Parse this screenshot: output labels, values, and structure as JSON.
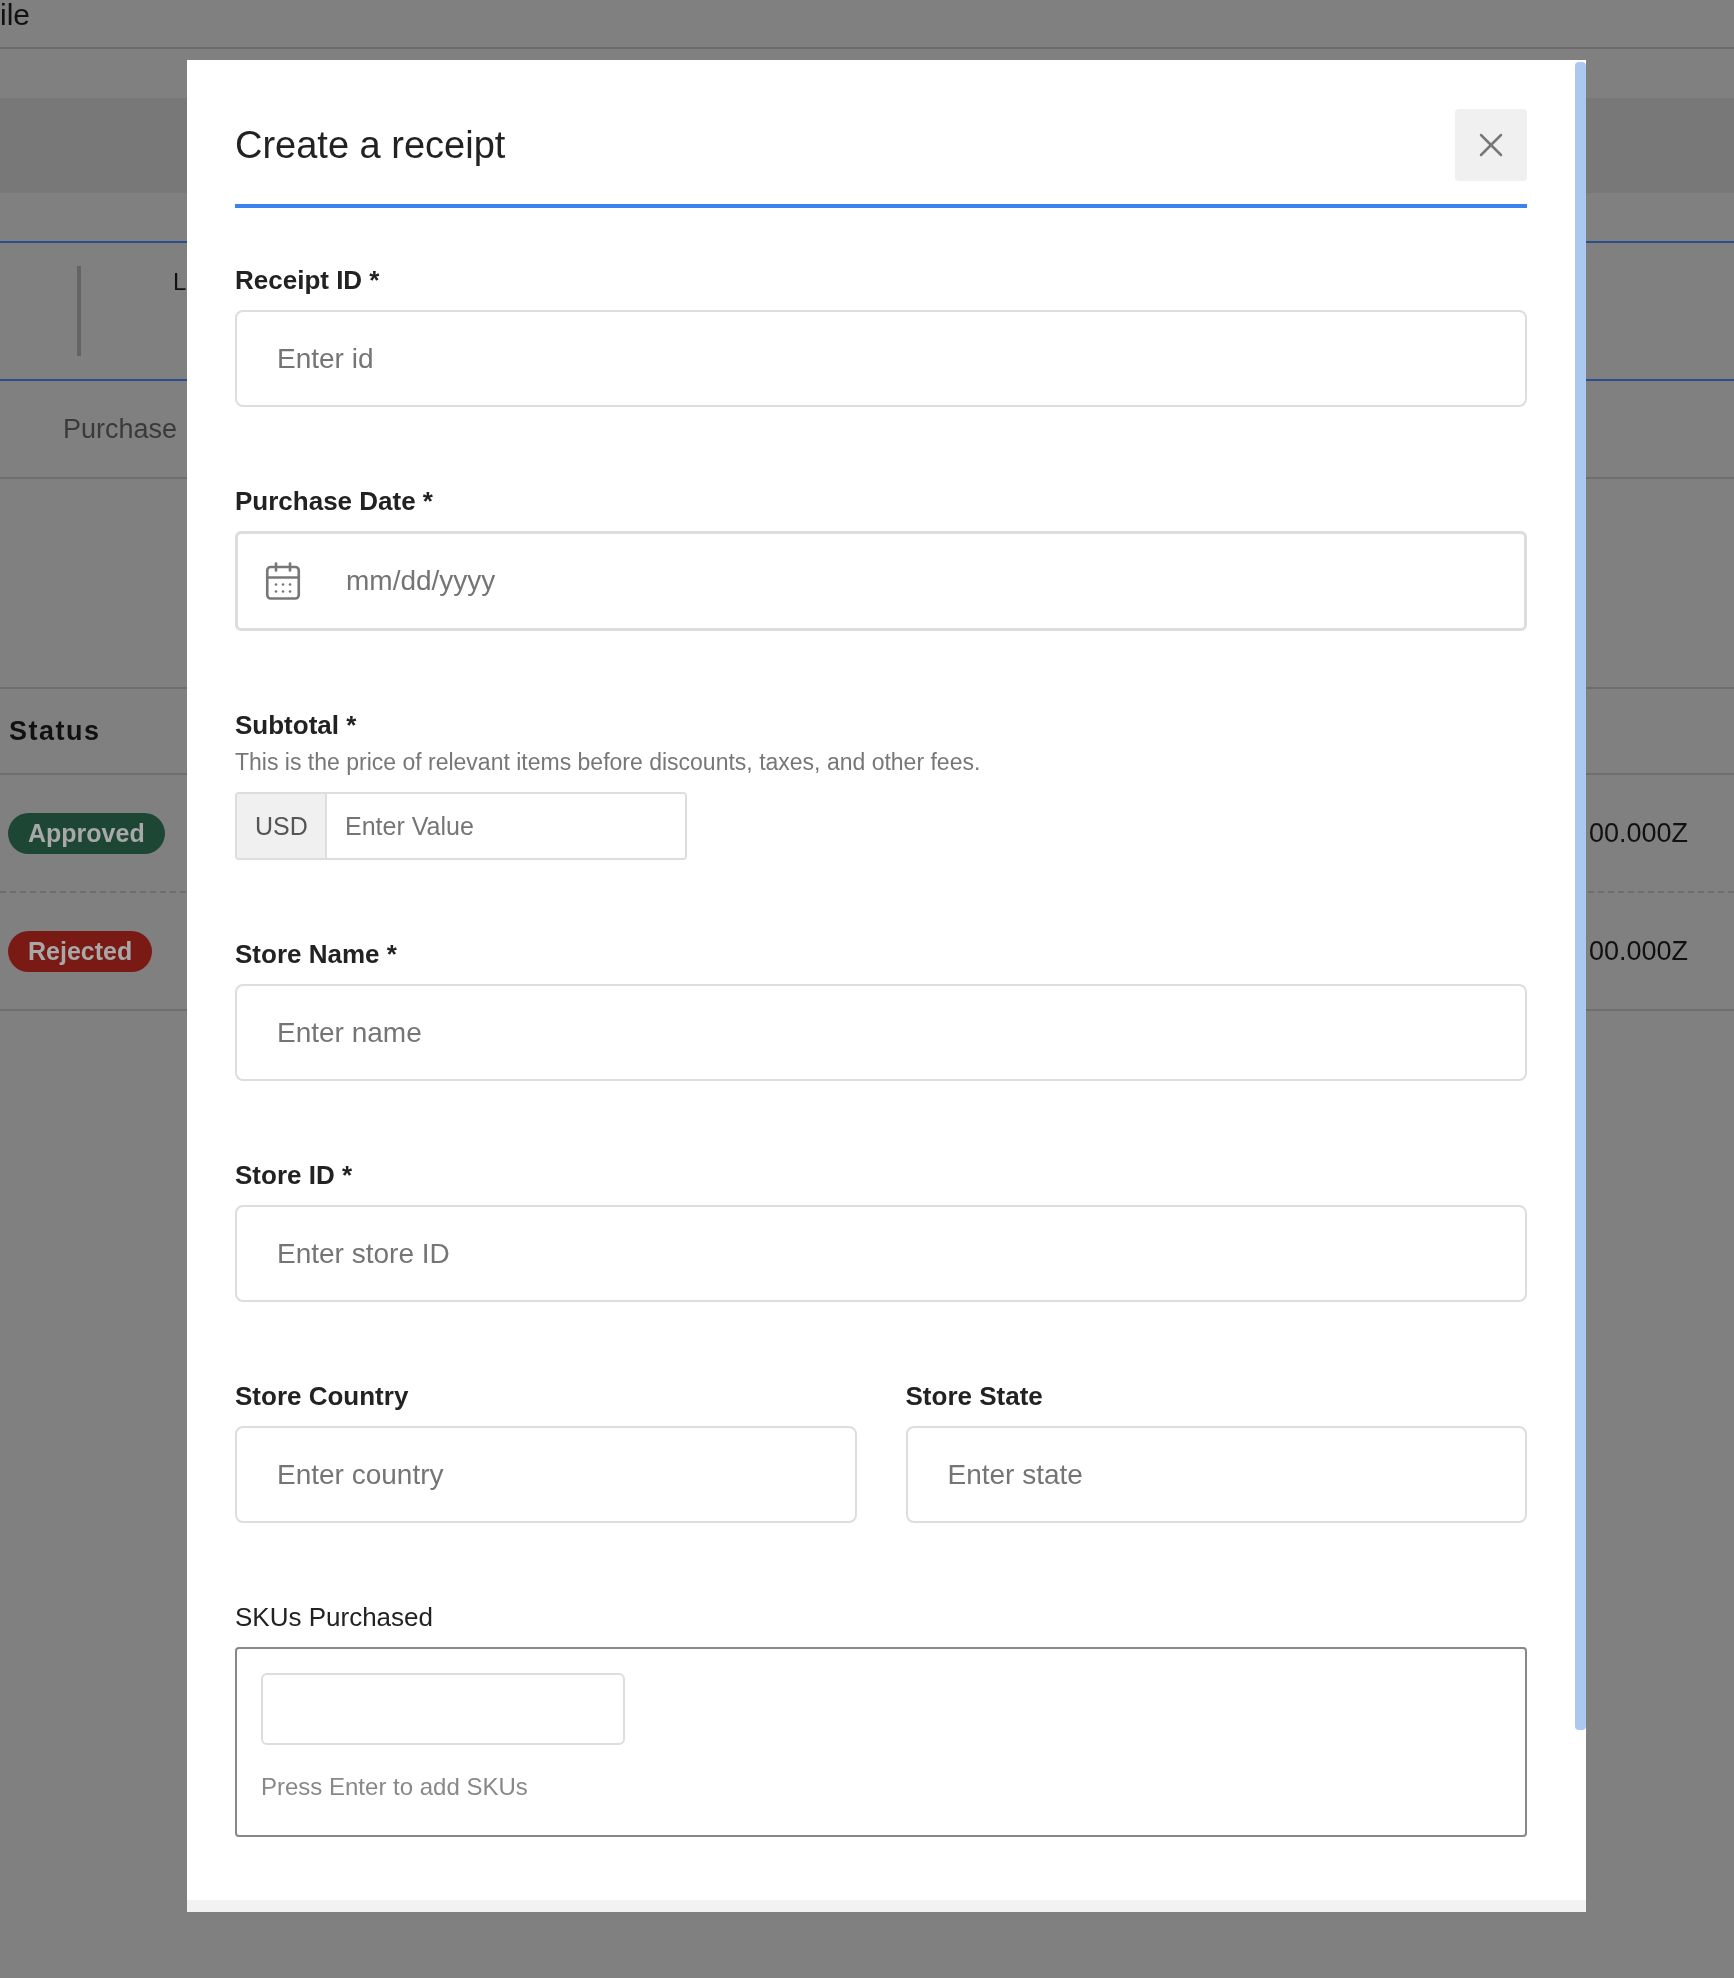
{
  "background": {
    "page_title": "ile",
    "card_lines": [
      "L"
    ],
    "tab": "Purchase",
    "table": {
      "columns": [
        "Status"
      ],
      "rows": [
        {
          "status": "Approved",
          "color": "#1d4634",
          "column_2": "00.000Z"
        },
        {
          "status": "Rejected",
          "color": "#7a1a14",
          "column_2": "00.000Z"
        }
      ]
    }
  },
  "dialog": {
    "title": "Create a receipt",
    "rows": [
      {
        "fields": [
          {
            "kind": "text",
            "label": "Receipt ID *",
            "placeholder": "Enter id"
          }
        ]
      },
      {
        "fields": [
          {
            "kind": "date",
            "label": "Purchase Date *",
            "placeholder": "mm/dd/yyyy"
          }
        ]
      },
      {
        "fields": [
          {
            "kind": "currency",
            "label": "Subtotal *",
            "help": "This is the price of relevant items before discounts, taxes, and other fees.",
            "currency": "USD",
            "placeholder": "Enter Value"
          }
        ]
      },
      {
        "fields": [
          {
            "kind": "text",
            "label": "Store Name *",
            "placeholder": "Enter name"
          }
        ]
      },
      {
        "fields": [
          {
            "kind": "text",
            "label": "Store ID *",
            "placeholder": "Enter store ID"
          }
        ]
      },
      {
        "fields": [
          {
            "kind": "text",
            "label": "Store Country",
            "placeholder": "Enter country"
          },
          {
            "kind": "text",
            "label": "Store State",
            "placeholder": "Enter state"
          }
        ]
      },
      {
        "fields": [
          {
            "kind": "tags",
            "label": "SKUs Purchased",
            "hint": "Press Enter to add SKUs"
          }
        ]
      }
    ]
  }
}
